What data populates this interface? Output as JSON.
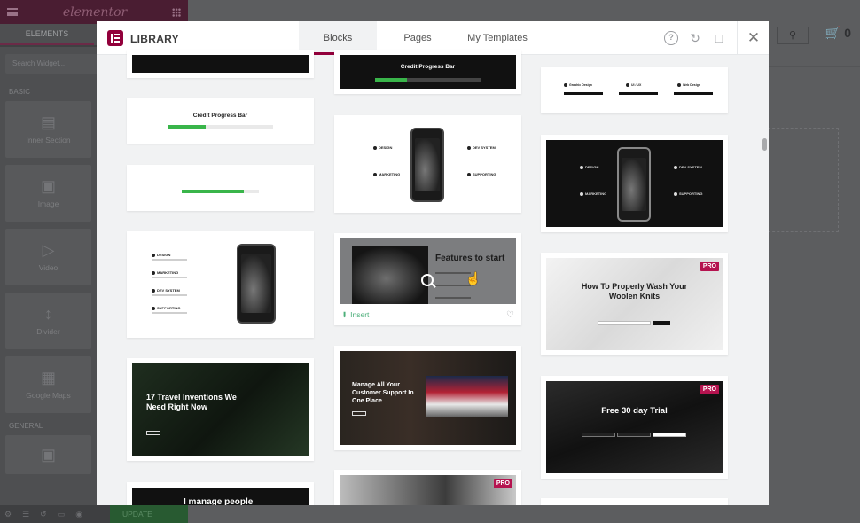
{
  "editor": {
    "brand": "elementor",
    "tabs": [
      "ELEMENTS"
    ],
    "search_placeholder": "Search Widget...",
    "categories": [
      "BASIC",
      "GENERAL"
    ],
    "widgets": [
      {
        "label": "Inner Section",
        "icon": "columns-icon"
      },
      {
        "label": "Image",
        "icon": "image-icon"
      },
      {
        "label": "Video",
        "icon": "video-icon"
      },
      {
        "label": "Divider",
        "icon": "divider-icon"
      },
      {
        "label": "Google Maps",
        "icon": "map-icon"
      }
    ],
    "update_label": "UPDATE",
    "cart_count": "0"
  },
  "library": {
    "title": "LIBRARY",
    "tabs": [
      {
        "label": "Blocks",
        "active": true
      },
      {
        "label": "Pages",
        "active": false
      },
      {
        "label": "My Templates",
        "active": false
      }
    ],
    "accent": "#92003b",
    "cards": {
      "credit_progress_bar_a": "Credit Progress Bar",
      "credit_progress_bar_b": "Credit Progress Bar",
      "features_to_start": "Features to start",
      "wash_title": "How To Properly Wash Your Woolen Knits",
      "travel_title": "17 Travel Inventions We Need Right Now",
      "manage_title": "Manage All Your Customer Support In One Place",
      "trial_title": "Free 30 day Trial",
      "manage_people": "I manage people",
      "pro_label": "PRO",
      "insert_label": "Insert",
      "services": [
        "Graphic Design",
        "UI / UX",
        "Web Design"
      ],
      "features": [
        "DESIGN",
        "MARKETING",
        "DEV SYSTEM",
        "SUPPORTING"
      ]
    }
  }
}
